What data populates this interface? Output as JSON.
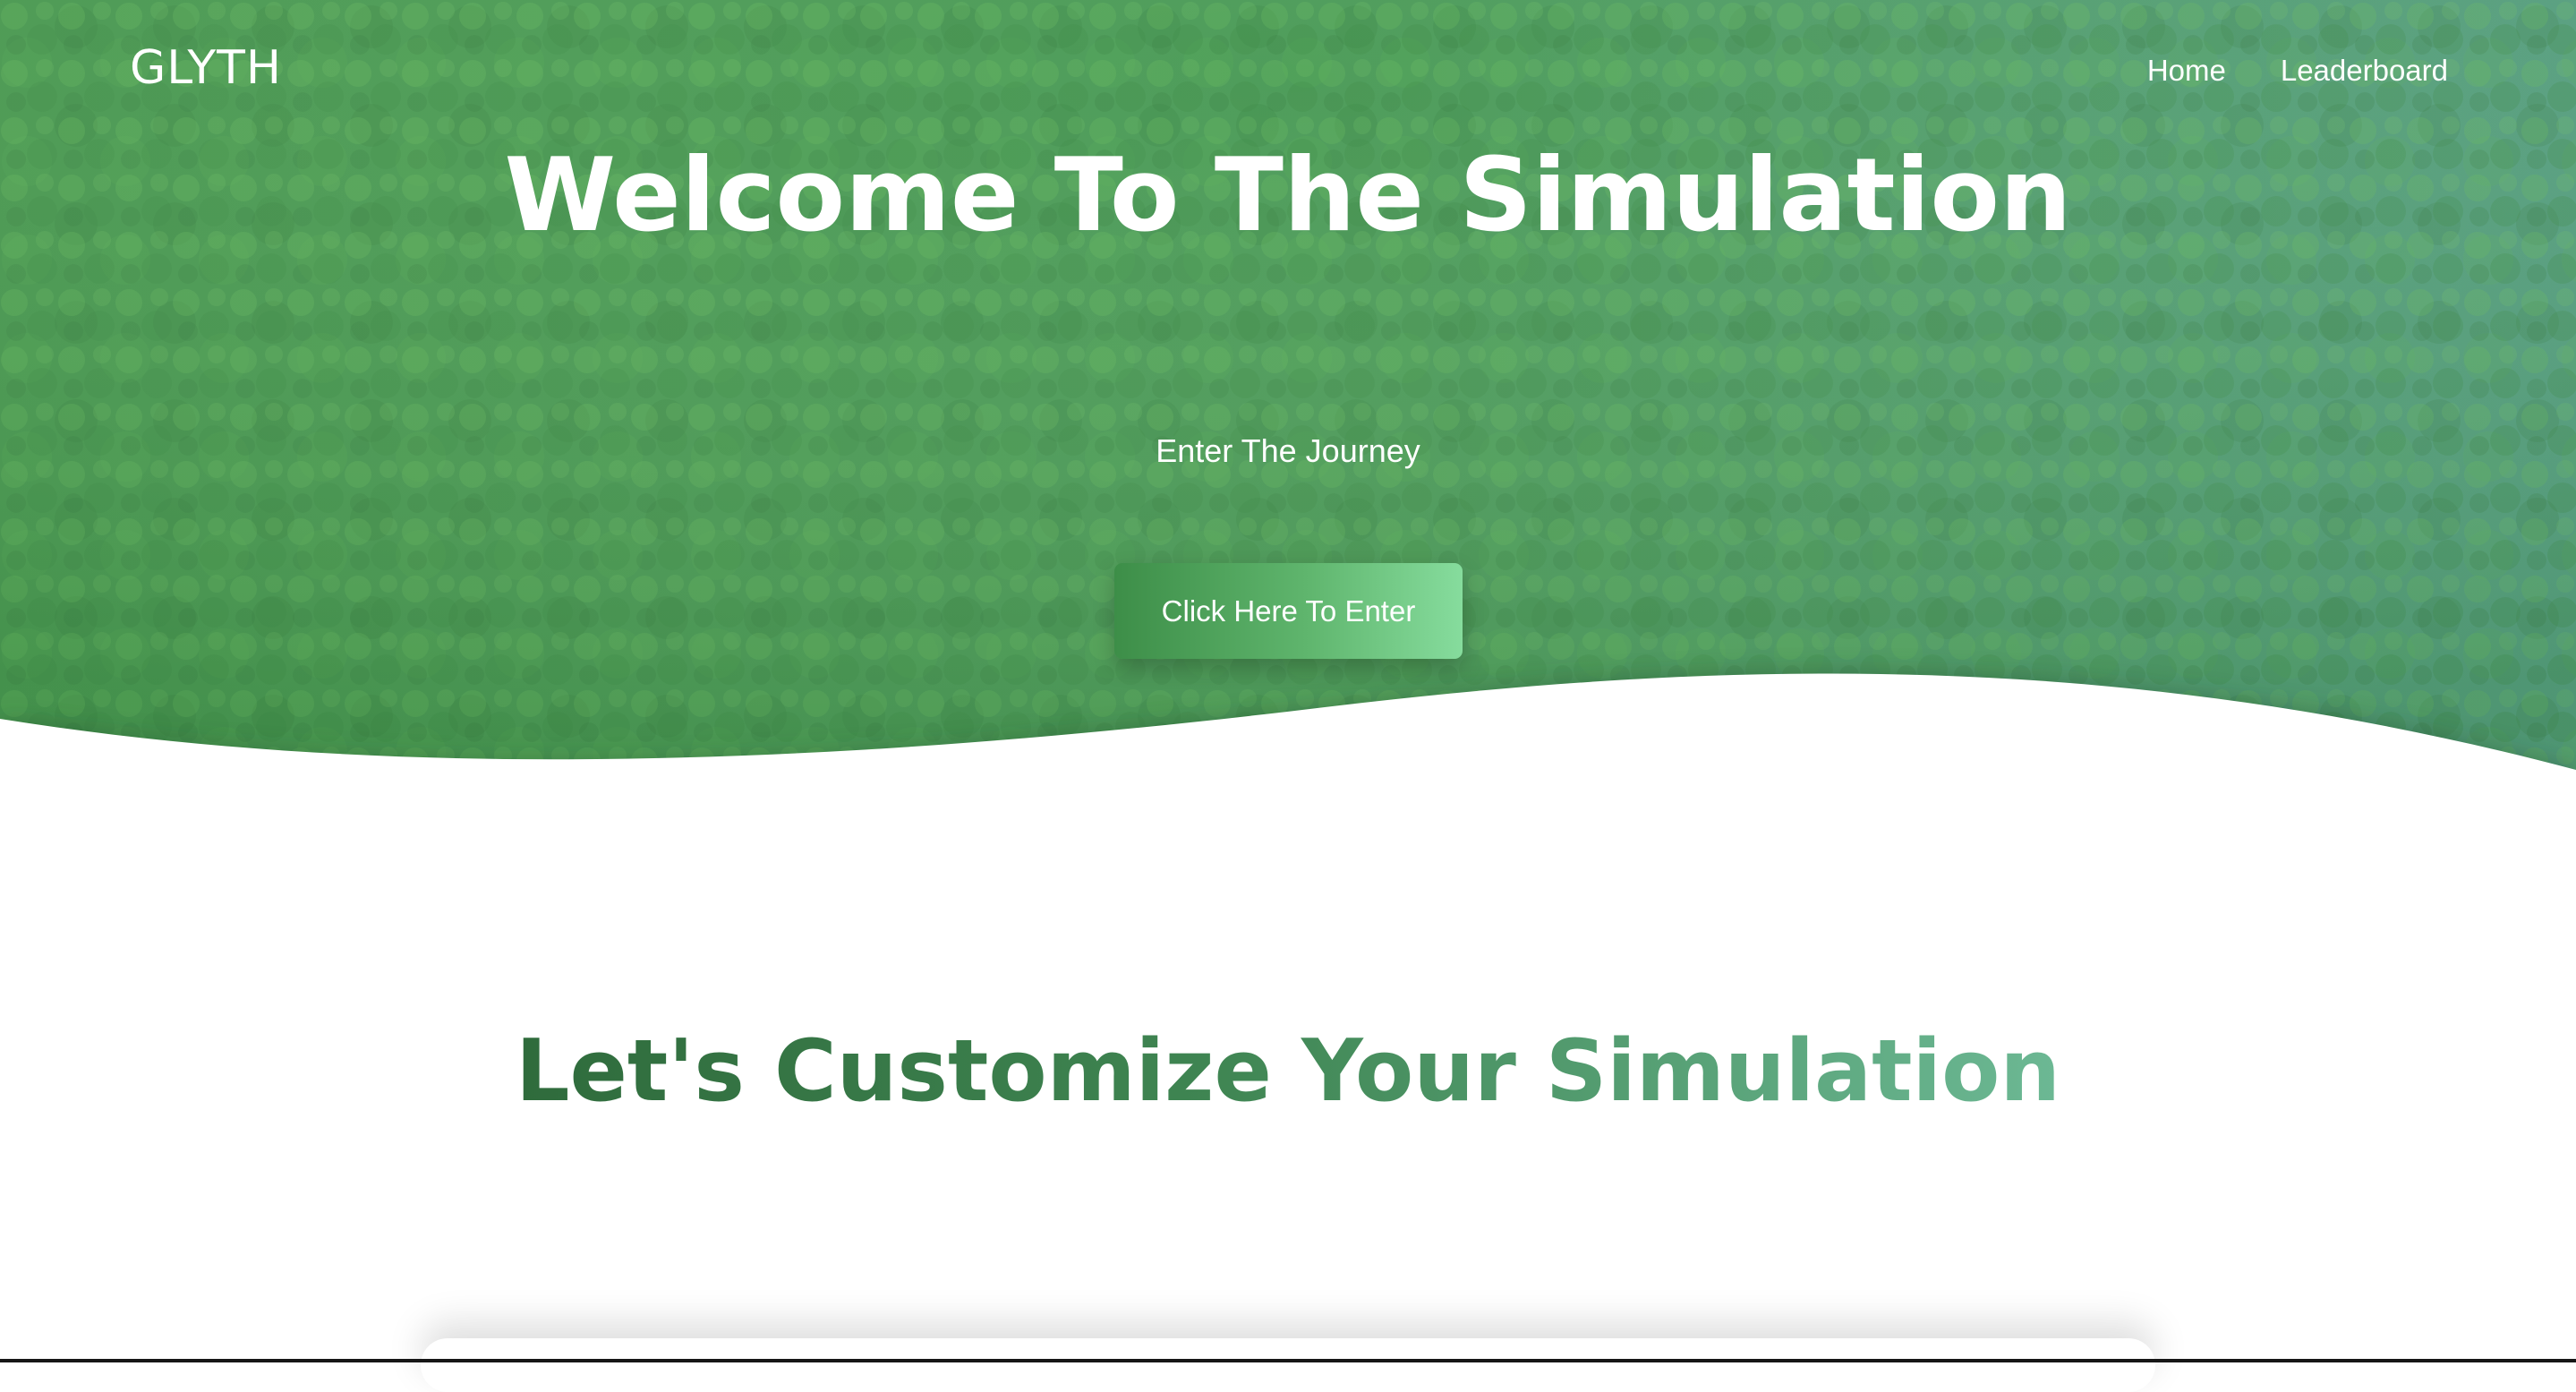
{
  "header": {
    "logo": "GLYTH",
    "nav": [
      "Home",
      "Leaderboard"
    ]
  },
  "hero": {
    "title": "Welcome To The Simulation",
    "subtitle": "Enter The Journey",
    "cta_label": "Click Here To Enter",
    "background": "aerial-forest-image"
  },
  "customize": {
    "title": "Let's Customize Your Simulation"
  },
  "colors": {
    "hero_overlay_left": "#4e9d57",
    "hero_overlay_right": "#5aa280",
    "button_start": "#3d8e48",
    "button_end": "#86dc9d",
    "heading_dark_green": "#2f6b3c",
    "heading_light_green": "#6cb894"
  }
}
